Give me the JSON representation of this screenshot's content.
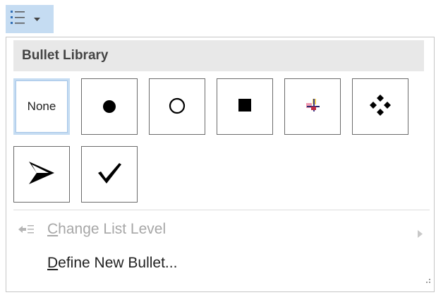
{
  "toolbar": {
    "button_icon": "bullet-list-icon",
    "dropdown_icon": "chevron-down-icon",
    "accent_color": "#c5dcf2"
  },
  "panel": {
    "section_title": "Bullet Library",
    "bullets": [
      {
        "id": "none",
        "label": "None",
        "selected": true
      },
      {
        "id": "filled-circle",
        "icon": "filled-circle-icon"
      },
      {
        "id": "hollow-circle",
        "icon": "hollow-circle-icon"
      },
      {
        "id": "filled-square",
        "icon": "filled-square-icon"
      },
      {
        "id": "color-cross",
        "icon": "color-cross-icon"
      },
      {
        "id": "four-diamonds",
        "icon": "four-diamonds-icon"
      },
      {
        "id": "arrowhead",
        "icon": "arrowhead-icon"
      },
      {
        "id": "checkmark",
        "icon": "checkmark-icon"
      }
    ],
    "menu": {
      "change_list_level": {
        "mnemonic": "C",
        "rest": "hange List Level",
        "enabled": false
      },
      "define_new_bullet": {
        "mnemonic": "D",
        "rest": "efine New Bullet...",
        "enabled": true
      }
    }
  }
}
